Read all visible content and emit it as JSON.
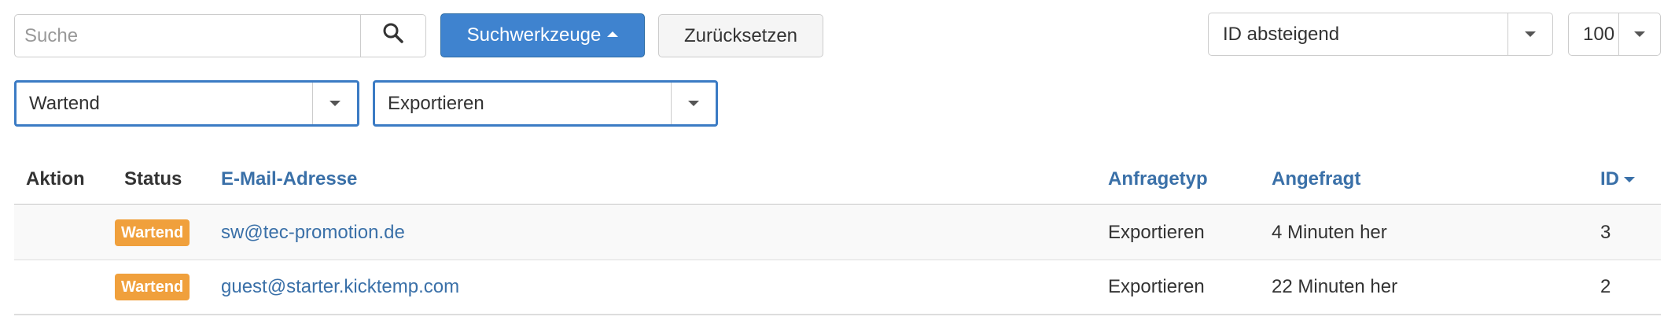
{
  "toolbar": {
    "search_placeholder": "Suche",
    "search_value": "",
    "search_tools_label": "Suchwerkzeuge",
    "reset_label": "Zurücksetzen",
    "sort_value": "ID absteigend",
    "limit_value": "100"
  },
  "filters": {
    "status_value": "Wartend",
    "type_value": "Exportieren"
  },
  "table": {
    "headers": {
      "action": "Aktion",
      "status": "Status",
      "email": "E-Mail-Adresse",
      "request_type": "Anfragetyp",
      "requested": "Angefragt",
      "id": "ID"
    },
    "rows": [
      {
        "status": "Wartend",
        "email": "sw@tec-promotion.de",
        "request_type": "Exportieren",
        "requested": "4 Minuten her",
        "id": "3"
      },
      {
        "status": "Wartend",
        "email": "guest@starter.kicktemp.com",
        "request_type": "Exportieren",
        "requested": "22 Minuten her",
        "id": "2"
      }
    ]
  },
  "icons": {
    "search": "search-icon",
    "caret_up": "caret-up-icon",
    "caret_down": "chevron-down-icon",
    "sort_desc": "sort-desc-icon"
  },
  "colors": {
    "primary": "#3f83cf",
    "link": "#3a70a8",
    "badge_pending": "#f0a03c",
    "filter_border": "#3b7bc4"
  }
}
